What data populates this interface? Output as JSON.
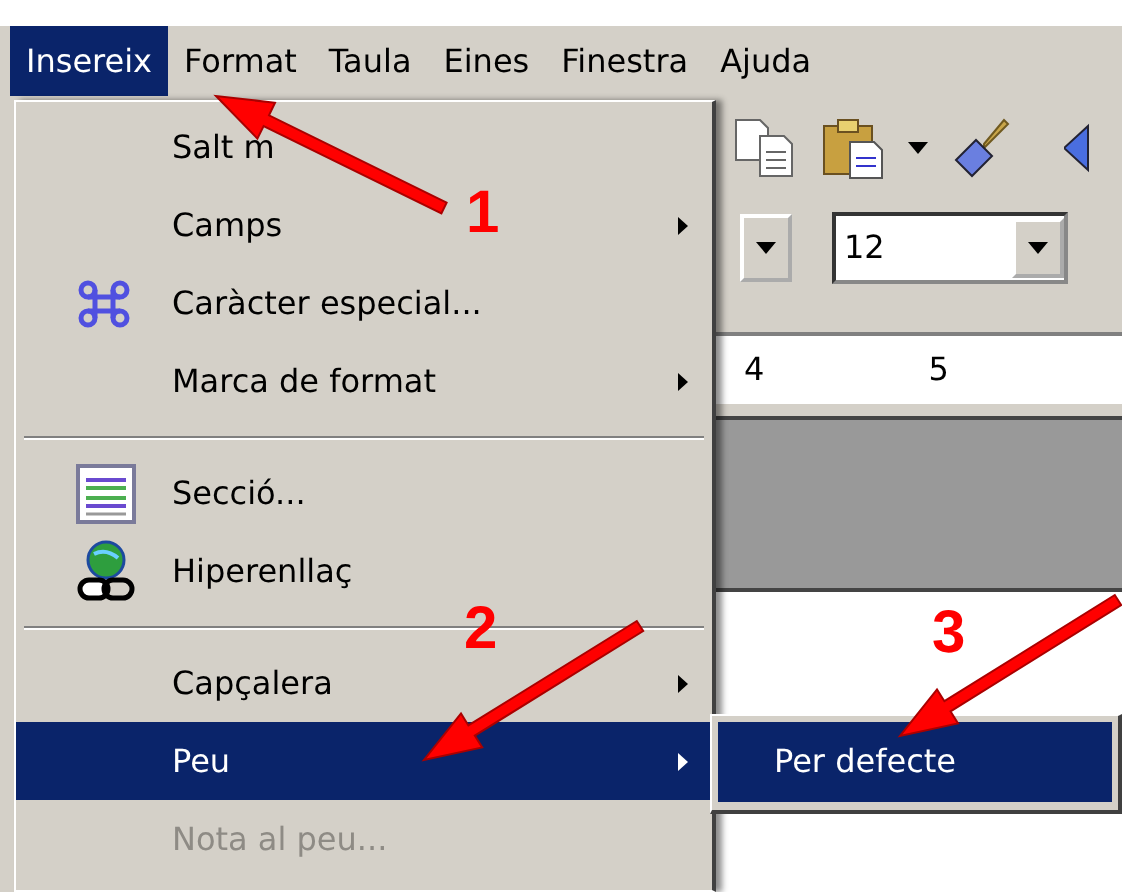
{
  "menubar": [
    {
      "label": "Insereix",
      "selected": true
    },
    {
      "label": "Format",
      "selected": false
    },
    {
      "label": "Taula",
      "selected": false
    },
    {
      "label": "Eines",
      "selected": false
    },
    {
      "label": "Finestra",
      "selected": false
    },
    {
      "label": "Ajuda",
      "selected": false
    }
  ],
  "toolbar": {
    "font_size": "12"
  },
  "ruler": {
    "marks": [
      "4",
      "5"
    ]
  },
  "menu": {
    "items": [
      {
        "kind": "item",
        "label": "Salt m",
        "submenu": false,
        "disabled": false,
        "selected": false
      },
      {
        "kind": "item",
        "label": "Camps",
        "submenu": true,
        "disabled": false,
        "selected": false
      },
      {
        "kind": "item",
        "label": "Caràcter especial...",
        "submenu": false,
        "disabled": false,
        "selected": false
      },
      {
        "kind": "item",
        "label": "Marca de format",
        "submenu": true,
        "disabled": false,
        "selected": false
      },
      {
        "kind": "separator"
      },
      {
        "kind": "item",
        "label": "Secció...",
        "submenu": false,
        "disabled": false,
        "selected": false
      },
      {
        "kind": "item",
        "label": "Hiperenllaç",
        "submenu": false,
        "disabled": false,
        "selected": false
      },
      {
        "kind": "separator"
      },
      {
        "kind": "item",
        "label": "Capçalera",
        "submenu": true,
        "disabled": false,
        "selected": false
      },
      {
        "kind": "item",
        "label": "Peu",
        "submenu": true,
        "disabled": false,
        "selected": true
      },
      {
        "kind": "item",
        "label": "Nota al peu...",
        "submenu": false,
        "disabled": true,
        "selected": false
      }
    ]
  },
  "submenu": {
    "items": [
      {
        "label": "Per defecte",
        "selected": true
      }
    ]
  },
  "annotations": [
    {
      "label": "1"
    },
    {
      "label": "2"
    },
    {
      "label": "3"
    }
  ]
}
